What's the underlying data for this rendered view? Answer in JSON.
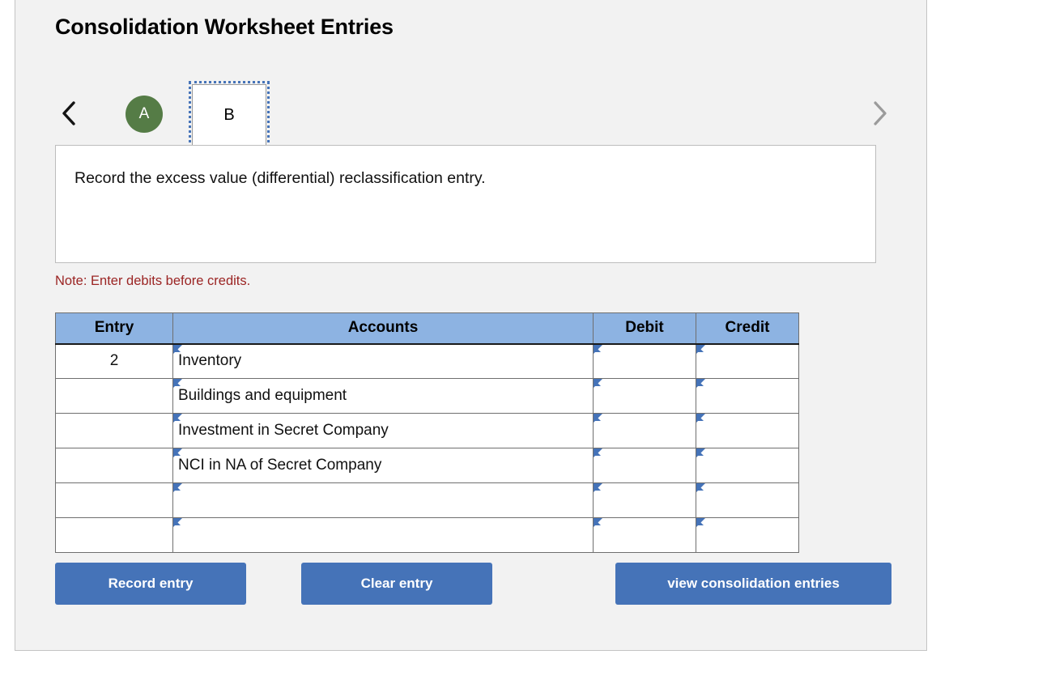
{
  "panel": {
    "title": "Consolidation Worksheet Entries"
  },
  "tabs": {
    "prev_icon": "chevron-left-icon",
    "next_icon": "chevron-right-icon",
    "items": [
      {
        "label": "A",
        "state": "completed"
      },
      {
        "label": "B",
        "state": "selected"
      }
    ]
  },
  "instruction": {
    "text": "Record the excess value (differential) reclassification entry."
  },
  "note": {
    "text": "Note: Enter debits before credits."
  },
  "journal": {
    "headers": {
      "entry": "Entry",
      "accounts": "Accounts",
      "debit": "Debit",
      "credit": "Credit"
    },
    "rows": [
      {
        "entry": "2",
        "account": "Inventory",
        "debit": "",
        "credit": ""
      },
      {
        "entry": "",
        "account": "Buildings and equipment",
        "debit": "",
        "credit": ""
      },
      {
        "entry": "",
        "account": "Investment in Secret Company",
        "debit": "",
        "credit": ""
      },
      {
        "entry": "",
        "account": "NCI in NA of Secret Company",
        "debit": "",
        "credit": ""
      },
      {
        "entry": "",
        "account": "",
        "debit": "",
        "credit": ""
      },
      {
        "entry": "",
        "account": "",
        "debit": "",
        "credit": ""
      }
    ]
  },
  "actions": {
    "record": "Record entry",
    "clear": "Clear entry",
    "view": "view consolidation entries"
  },
  "colors": {
    "header_blue": "#8db3e2",
    "button_blue": "#4573b8",
    "tab_green": "#557c46",
    "note_red": "#9b2423",
    "panel_bg": "#f2f2f2",
    "marker_blue": "#4573b8"
  }
}
